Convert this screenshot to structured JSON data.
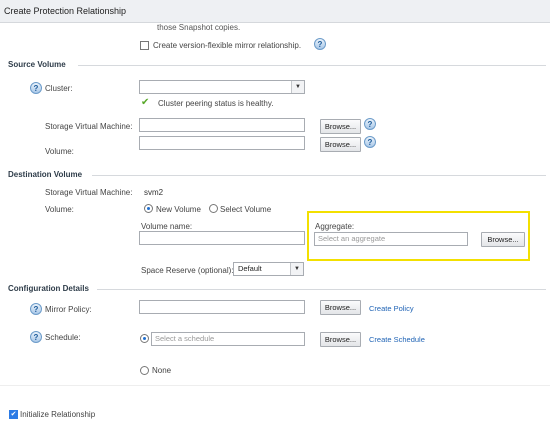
{
  "window": {
    "title": "Create Protection Relationship"
  },
  "top": {
    "clipped_text": "those Snapshot copies.",
    "version_flexible_label": "Create version-flexible mirror relationship."
  },
  "source": {
    "heading": "Source Volume",
    "cluster_label": "Cluster:",
    "peering_status": "Cluster peering status is healthy.",
    "svm_label": "Storage Virtual Machine:",
    "volume_label": "Volume:",
    "browse": "Browse..."
  },
  "destination": {
    "heading": "Destination Volume",
    "svm_label": "Storage Virtual Machine:",
    "svm_value": "svm2",
    "volume_label": "Volume:",
    "new_volume": "New Volume",
    "select_volume": "Select Volume",
    "volume_name_label": "Volume name:",
    "aggregate_label": "Aggregate:",
    "aggregate_placeholder": "Select an aggregate",
    "browse": "Browse...",
    "space_reserve_label": "Space Reserve (optional):",
    "space_reserve_value": "Default"
  },
  "config": {
    "heading": "Configuration Details",
    "mirror_policy_label": "Mirror Policy:",
    "browse": "Browse...",
    "create_policy": "Create Policy",
    "schedule_label": "Schedule:",
    "schedule_placeholder": "Select a schedule",
    "create_schedule": "Create Schedule",
    "none_label": "None"
  },
  "footer": {
    "initialize_label": "Initialize Relationship"
  },
  "icons": {
    "help": "?",
    "check": "✔",
    "dropdown": "▼"
  }
}
